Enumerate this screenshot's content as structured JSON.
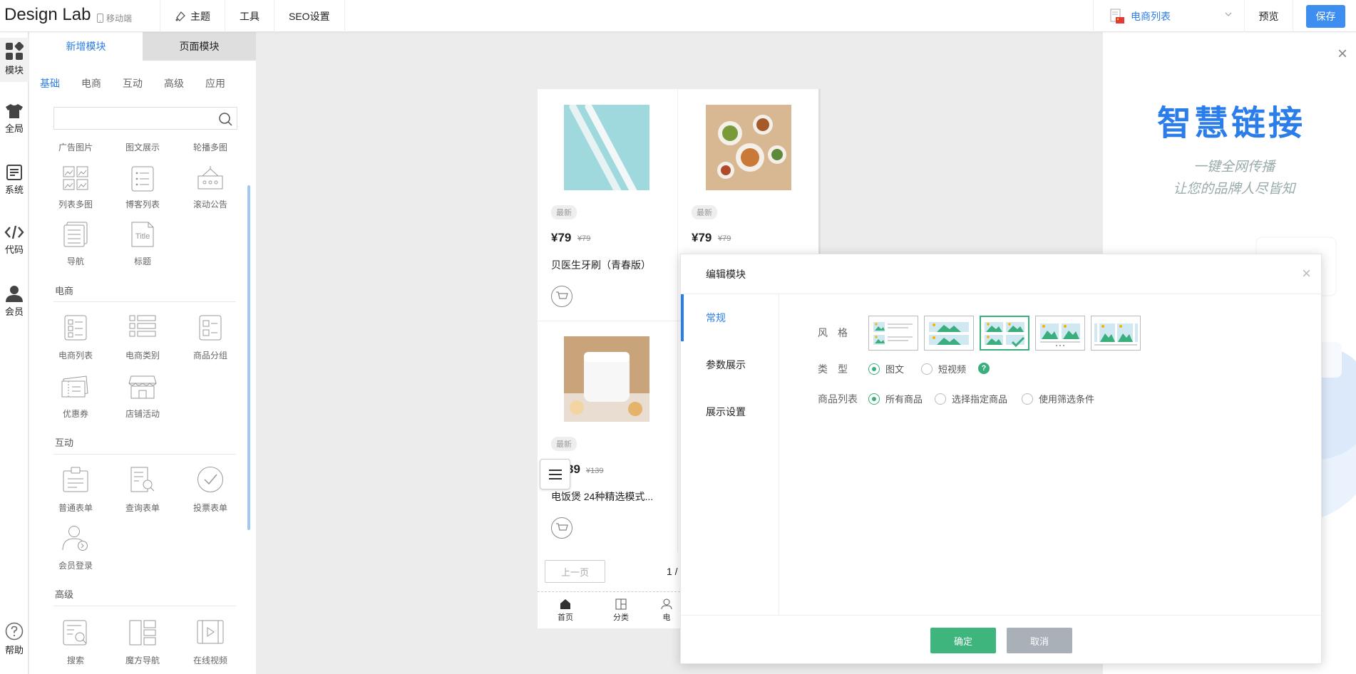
{
  "header": {
    "logo": "Design Lab",
    "mobile_label": "移动端",
    "nav": [
      "主题",
      "工具",
      "SEO设置"
    ],
    "page_select": "电商列表",
    "preview": "预览",
    "save": "保存"
  },
  "iconbar": {
    "items": [
      "模块",
      "全局",
      "系统",
      "代码",
      "会员"
    ],
    "help": "帮助"
  },
  "panel": {
    "tabs": [
      "新增模块",
      "页面模块"
    ],
    "categories": [
      "基础",
      "电商",
      "互动",
      "高级",
      "应用"
    ],
    "basic_row0": [
      "广告图片",
      "图文展示",
      "轮播多图"
    ],
    "basic_row1": [
      "列表多图",
      "博客列表",
      "滚动公告"
    ],
    "basic_row2": [
      "导航",
      "标题"
    ],
    "sections": [
      "电商",
      "互动",
      "高级"
    ],
    "ecom_row0": [
      "电商列表",
      "电商类别",
      "商品分组"
    ],
    "ecom_row1": [
      "优惠券",
      "店铺活动"
    ],
    "inter_row0": [
      "普通表单",
      "查询表单",
      "投票表单"
    ],
    "inter_row1": [
      "会员登录"
    ],
    "adv_row0": [
      "搜索",
      "魔方导航",
      "在线视频"
    ],
    "title_icon_text": "Title"
  },
  "phone": {
    "products": [
      {
        "badge": "最新",
        "price": "¥79",
        "old_price": "¥79",
        "name": "贝医生牙刷（青春版）"
      },
      {
        "badge": "最新",
        "price": "¥79",
        "old_price": "¥79",
        "name": ""
      },
      {
        "badge": "最新",
        "price": "39",
        "old_price": "¥139",
        "name": "电饭煲 24种精选模式..."
      }
    ],
    "prev_page": "上一页",
    "page_indicator": "1 /",
    "bottom_nav": [
      "首页",
      "分类",
      "电"
    ]
  },
  "ad": {
    "title": "智慧链接",
    "line1": "一键全网传播",
    "line2": "让您的品牌人尽皆知"
  },
  "modal": {
    "title": "编辑模块",
    "side_tabs": [
      "常规",
      "参数展示",
      "展示设置"
    ],
    "style_label": "风　格",
    "type_label": "类　型",
    "type_options": [
      "图文",
      "短视频"
    ],
    "type_selected": "图文",
    "list_label": "商品列表",
    "list_options": [
      "所有商品",
      "选择指定商品",
      "使用筛选条件"
    ],
    "list_selected": "所有商品",
    "selected_style_index": 2,
    "ok": "确定",
    "cancel": "取消"
  },
  "colors": {
    "accent": "#2b7de9",
    "confirm": "#3db57c",
    "selected_border": "#3aae7c"
  }
}
